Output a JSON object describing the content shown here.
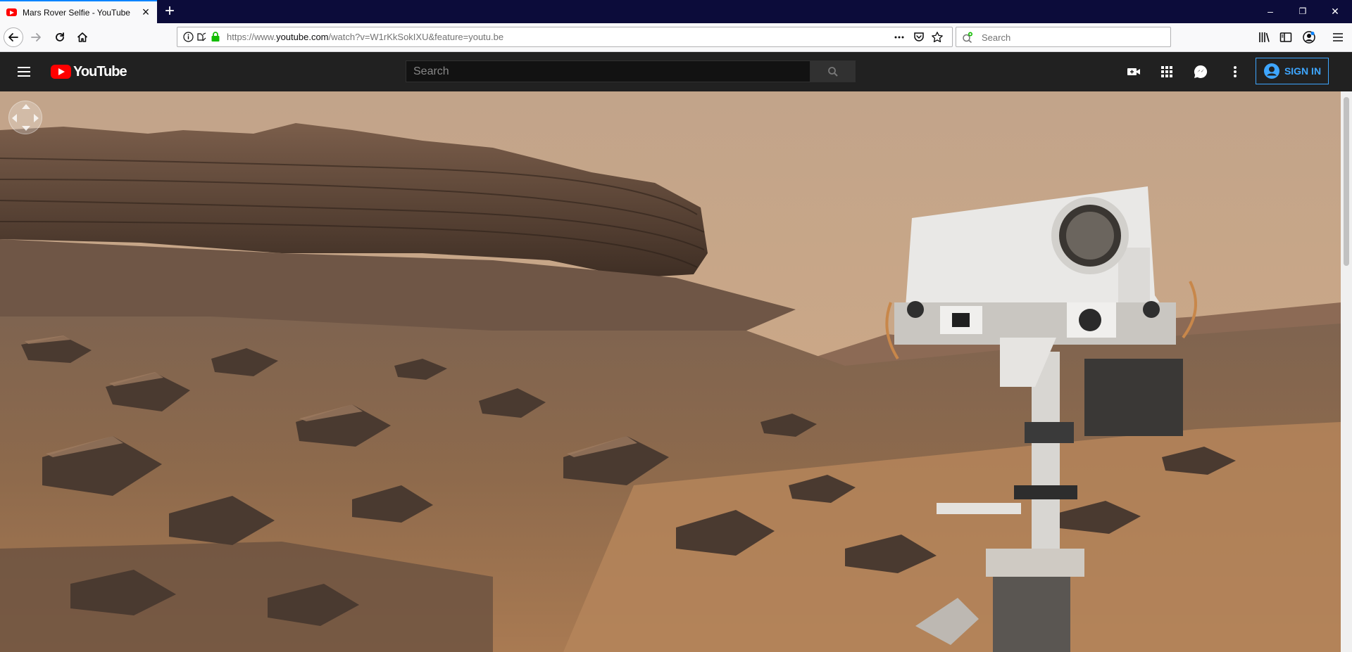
{
  "browser": {
    "tab": {
      "title": "Mars Rover Selfie - YouTube",
      "favicon": "youtube-favicon-icon"
    },
    "new_tab_label": "+",
    "window_controls": {
      "minimize": "–",
      "restore": "❐",
      "close": "✕"
    },
    "url": {
      "prefix": "https://www.",
      "host": "youtube.com",
      "path": "/watch?v=W1rKkSokIXU&feature=youtu.be"
    },
    "search_placeholder": "Search",
    "accent_color": "#0a84ff"
  },
  "youtube": {
    "logo_text": "YouTube",
    "search_placeholder": "Search",
    "sign_in_label": "SIGN IN",
    "brand_color": "#ff0000",
    "link_color": "#3ea6ff",
    "icons": [
      "menu-icon",
      "create-video-icon",
      "apps-icon",
      "messages-icon",
      "more-vertical-icon",
      "account-icon"
    ]
  },
  "video": {
    "kind": "360-degree panorama",
    "control": "pan-control-icon"
  }
}
